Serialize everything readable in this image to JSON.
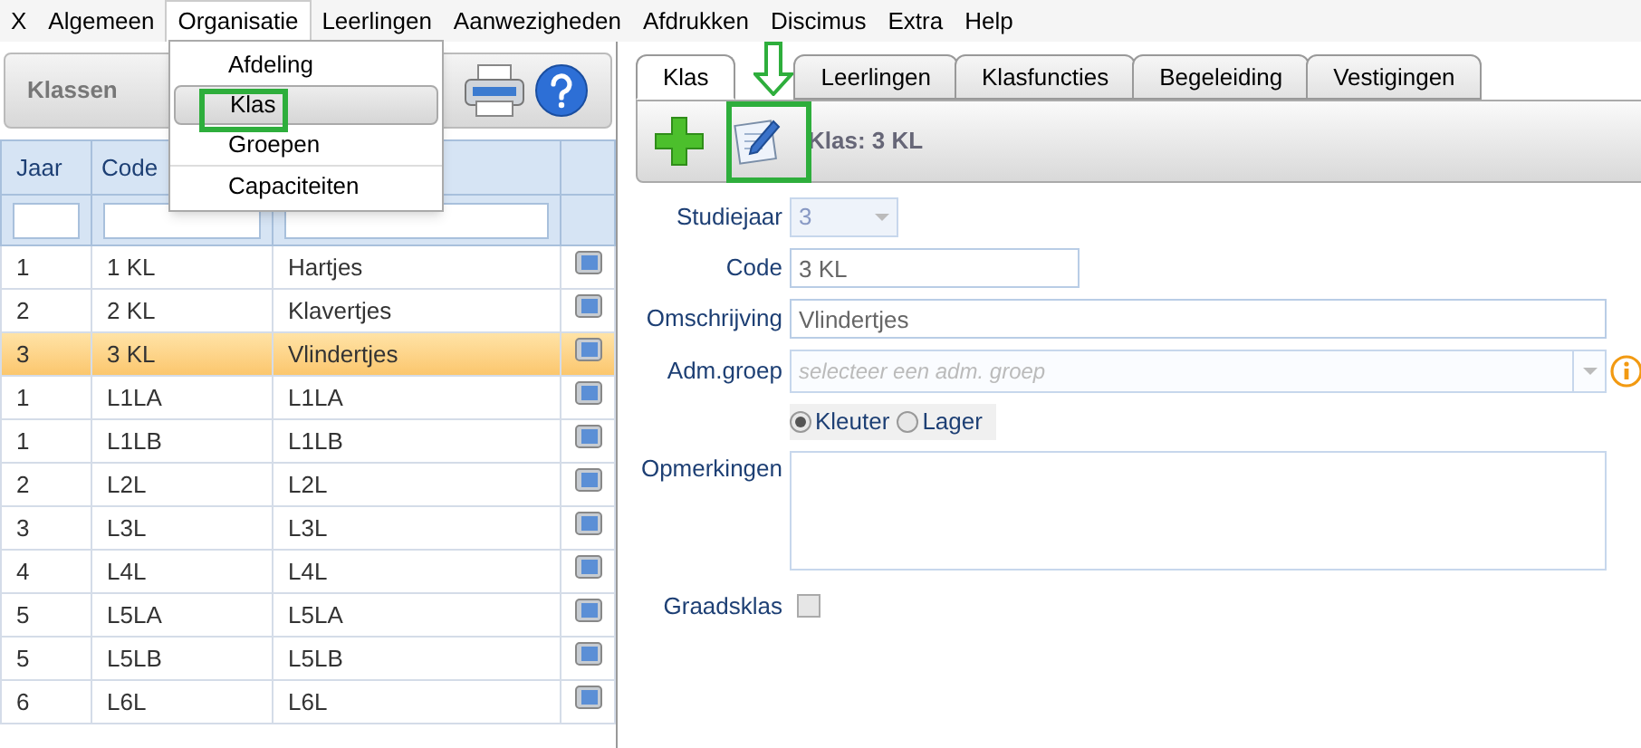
{
  "menu_bar": [
    {
      "label": "X",
      "selected": false
    },
    {
      "label": "Algemeen",
      "selected": false
    },
    {
      "label": "Organisatie",
      "selected": true
    },
    {
      "label": "Leerlingen",
      "selected": false
    },
    {
      "label": "Aanwezigheden",
      "selected": false
    },
    {
      "label": "Afdrukken",
      "selected": false
    },
    {
      "label": "Discimus",
      "selected": false
    },
    {
      "label": "Extra",
      "selected": false
    },
    {
      "label": "Help",
      "selected": false
    }
  ],
  "dropdown": [
    {
      "label": "Afdeling",
      "selected": false
    },
    {
      "label": "Klas",
      "selected": true
    },
    {
      "label": "Groepen",
      "selected": false
    },
    {
      "label": "Capaciteiten",
      "selected": false
    }
  ],
  "left_panel": {
    "title": "Klassen",
    "table": {
      "columns": [
        "Jaar",
        "Code"
      ],
      "rows": [
        {
          "cells": [
            "1",
            "1 KL",
            "Hartjes"
          ],
          "selected": false
        },
        {
          "cells": [
            "2",
            "2 KL",
            "Klavertjes"
          ],
          "selected": false
        },
        {
          "cells": [
            "3",
            "3 KL",
            "Vlindertjes"
          ],
          "selected": true
        },
        {
          "cells": [
            "1",
            "L1LA",
            "L1LA"
          ],
          "selected": false
        },
        {
          "cells": [
            "1",
            "L1LB",
            "L1LB"
          ],
          "selected": false
        },
        {
          "cells": [
            "2",
            "L2L",
            "L2L"
          ],
          "selected": false
        },
        {
          "cells": [
            "3",
            "L3L",
            "L3L"
          ],
          "selected": false
        },
        {
          "cells": [
            "4",
            "L4L",
            "L4L"
          ],
          "selected": false
        },
        {
          "cells": [
            "5",
            "L5LA",
            "L5LA"
          ],
          "selected": false
        },
        {
          "cells": [
            "5",
            "L5LB",
            "L5LB"
          ],
          "selected": false
        },
        {
          "cells": [
            "6",
            "L6L",
            "L6L"
          ],
          "selected": false
        }
      ]
    }
  },
  "right_panel": {
    "tabs": [
      {
        "label": "Klas",
        "selected": true
      },
      {
        "label": "Leerlingen",
        "selected": false
      },
      {
        "label": "Klasfuncties",
        "selected": false
      },
      {
        "label": "Begeleiding",
        "selected": false
      },
      {
        "label": "Vestigingen",
        "selected": false
      }
    ],
    "toolbar_title": "Klas: 3 KL",
    "form": {
      "studiejaar": {
        "label": "Studiejaar",
        "value": "3"
      },
      "code": {
        "label": "Code",
        "value": "3 KL"
      },
      "omschrijving": {
        "label": "Omschrijving",
        "value": "Vlindertjes"
      },
      "adm_groep": {
        "label": "Adm.groep",
        "placeholder": "selecteer een adm. groep"
      },
      "level_options": [
        {
          "label": "Kleuter",
          "selected": true
        },
        {
          "label": "Lager",
          "selected": false
        }
      ],
      "opmerkingen": {
        "label": "Opmerkingen"
      },
      "graadsklas": {
        "label": "Graadsklas",
        "checked": false
      }
    }
  }
}
